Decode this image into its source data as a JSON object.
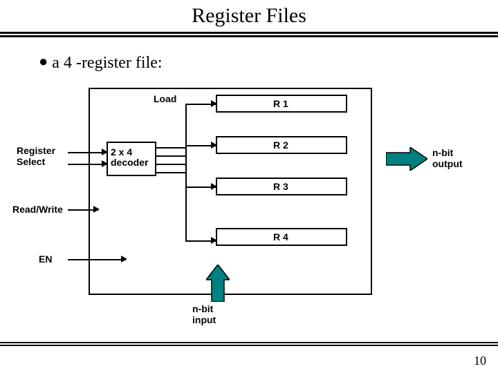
{
  "title": "Register Files",
  "bullet": "a 4 -register file:",
  "labels": {
    "load": "Load",
    "register_select": "Register\nSelect",
    "read_write": "Read/Write",
    "en": "EN",
    "decoder": "2 x 4\ndecoder",
    "nbit_output": "n-bit\noutput",
    "nbit_input": "n-bit\ninput"
  },
  "registers": [
    "R 1",
    "R 2",
    "R 3",
    "R 4"
  ],
  "colors": {
    "teal": "#008080",
    "highlight": "#ffff99"
  },
  "page": "10"
}
